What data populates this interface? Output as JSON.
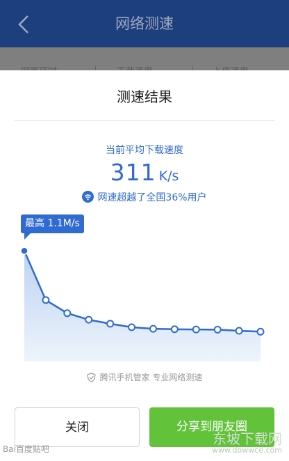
{
  "header": {
    "title": "网络测速",
    "back_icon": "chevron-left-icon"
  },
  "tabs": [
    {
      "label": "网路延时"
    },
    {
      "label": "下载速度"
    },
    {
      "label": "上传速度"
    }
  ],
  "dialog": {
    "title": "测速结果",
    "avg_label": "当前平均下载速度",
    "speed_value": "311",
    "speed_unit": "K/s",
    "beat_text": "网速超越了全国36%用户",
    "max_tooltip": "最高 1.1M/s",
    "brand_text": "腾讯手机管家 专业网络测速",
    "close_label": "关闭",
    "share_label": "分享到朋友圈"
  },
  "chart_data": {
    "type": "area",
    "x": [
      1,
      2,
      3,
      4,
      5,
      6,
      7,
      8,
      9,
      10,
      11,
      12
    ],
    "values": [
      1100,
      610,
      480,
      415,
      375,
      340,
      325,
      320,
      318,
      316,
      305,
      296
    ],
    "unit": "K/s",
    "ylim": [
      0,
      1150
    ],
    "colors": {
      "line": "#2f6bd0",
      "fill_top": "#bcd2f2",
      "fill_bottom": "#eef4fc"
    }
  },
  "colors": {
    "accent": "#2f6bd0",
    "share_green": "#62c23a",
    "header_bg": "#1d3f7e"
  },
  "watermarks": {
    "left": "Bai百度贴吧",
    "right_big": "东坡下载网",
    "right_small": "www.dowwce.com"
  }
}
